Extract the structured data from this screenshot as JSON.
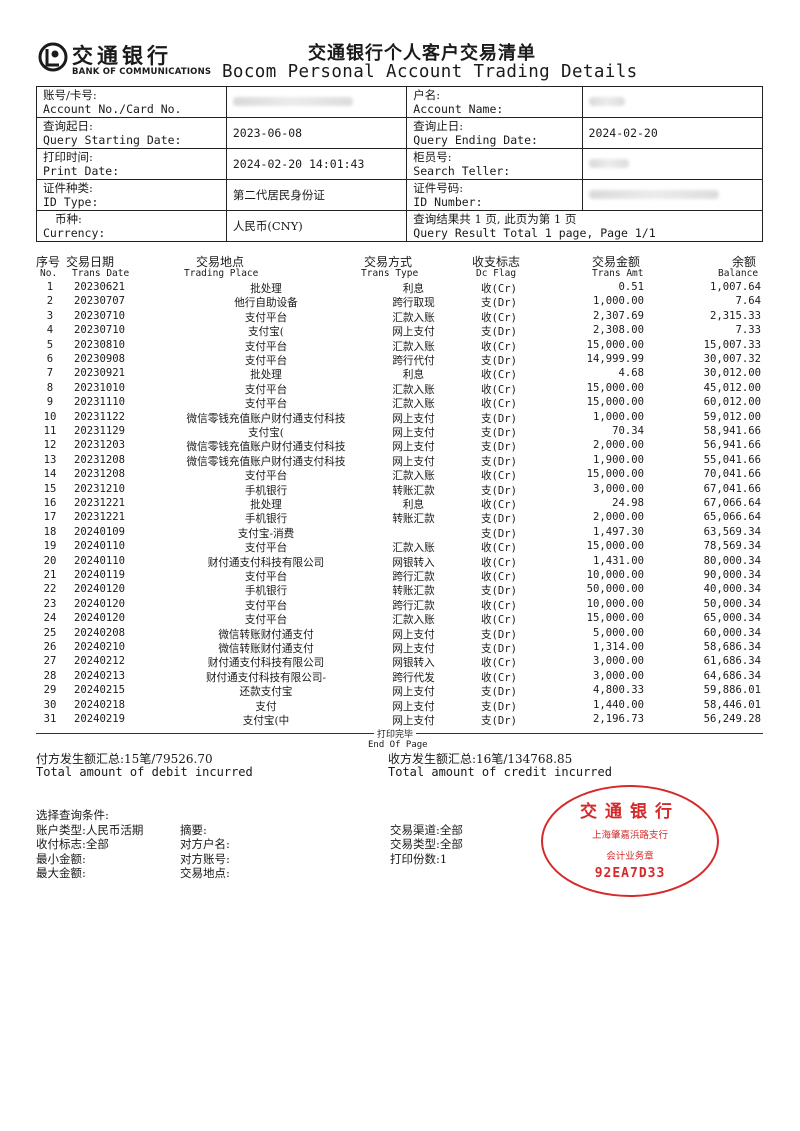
{
  "header": {
    "bank_name_cn": "交通银行",
    "bank_name_en": "BANK OF COMMUNICATIONS",
    "title_cn": "交通银行个人客户交易清单",
    "title_en": "Bocom Personal Account Trading Details",
    "brand_color": "#1a1a1a"
  },
  "info": {
    "account_label_cn": "账号/卡号:",
    "account_label_en": "Account No./Card No.",
    "name_label_cn": "户名:",
    "name_label_en": "Account Name:",
    "start_label_cn": "查询起日:",
    "start_label_en": "Query Starting Date:",
    "start_value": "2023-06-08",
    "end_label_cn": "查询止日:",
    "end_label_en": "Query Ending Date:",
    "end_value": "2024-02-20",
    "print_label_cn": "打印时间:",
    "print_label_en": "Print Date:",
    "print_value": "2024-02-20 14:01:43",
    "teller_label_cn": "柜员号:",
    "teller_label_en": "Search Teller:",
    "idtype_label_cn": "证件种类:",
    "idtype_label_en": "ID Type:",
    "idtype_value": "第二代居民身份证",
    "idnum_label_cn": "证件号码:",
    "idnum_label_en": "ID Number:",
    "currency_label_cn": "币种:",
    "currency_label_en": "Currency:",
    "currency_value": "人民币(CNY)",
    "result_cn": "查询结果共 1 页, 此页为第 1 页",
    "result_en": "Query Result Total 1 page, Page 1/1"
  },
  "columns": {
    "no_cn": "序号",
    "no_en": "No.",
    "date_cn": "交易日期",
    "date_en": "Trans Date",
    "place_cn": "交易地点",
    "place_en": "Trading Place",
    "type_cn": "交易方式",
    "type_en": "Trans Type",
    "flag_cn": "收支标志",
    "flag_en": "Dc Flag",
    "amt_cn": "交易金额",
    "amt_en": "Trans Amt",
    "bal_cn": "余额",
    "bal_en": "Balance"
  },
  "transactions": [
    {
      "no": "1",
      "date": "20230621",
      "place": "批处理",
      "type": "利息",
      "flag": "收(Cr)",
      "amt": "0.51",
      "bal": "1,007.64"
    },
    {
      "no": "2",
      "date": "20230707",
      "place": "他行自助设备",
      "type": "跨行取现",
      "flag": "支(Dr)",
      "amt": "1,000.00",
      "bal": "7.64"
    },
    {
      "no": "3",
      "date": "20230710",
      "place": "支付平台",
      "type": "汇款入账",
      "flag": "收(Cr)",
      "amt": "2,307.69",
      "bal": "2,315.33"
    },
    {
      "no": "4",
      "date": "20230710",
      "place": "支付宝(",
      "type": "网上支付",
      "flag": "支(Dr)",
      "amt": "2,308.00",
      "bal": "7.33"
    },
    {
      "no": "5",
      "date": "20230810",
      "place": "支付平台",
      "type": "汇款入账",
      "flag": "收(Cr)",
      "amt": "15,000.00",
      "bal": "15,007.33"
    },
    {
      "no": "6",
      "date": "20230908",
      "place": "支付平台",
      "type": "跨行代付",
      "flag": "支(Dr)",
      "amt": "14,999.99",
      "bal": "30,007.32"
    },
    {
      "no": "7",
      "date": "20230921",
      "place": "批处理",
      "type": "利息",
      "flag": "收(Cr)",
      "amt": "4.68",
      "bal": "30,012.00"
    },
    {
      "no": "8",
      "date": "20231010",
      "place": "支付平台",
      "type": "汇款入账",
      "flag": "收(Cr)",
      "amt": "15,000.00",
      "bal": "45,012.00"
    },
    {
      "no": "9",
      "date": "20231110",
      "place": "支付平台",
      "type": "汇款入账",
      "flag": "收(Cr)",
      "amt": "15,000.00",
      "bal": "60,012.00"
    },
    {
      "no": "10",
      "date": "20231122",
      "place": "微信零钱充值账户财付通支付科技",
      "type": "网上支付",
      "flag": "支(Dr)",
      "amt": "1,000.00",
      "bal": "59,012.00"
    },
    {
      "no": "11",
      "date": "20231129",
      "place": "支付宝(",
      "type": "网上支付",
      "flag": "支(Dr)",
      "amt": "70.34",
      "bal": "58,941.66"
    },
    {
      "no": "12",
      "date": "20231203",
      "place": "微信零钱充值账户财付通支付科技",
      "type": "网上支付",
      "flag": "支(Dr)",
      "amt": "2,000.00",
      "bal": "56,941.66"
    },
    {
      "no": "13",
      "date": "20231208",
      "place": "微信零钱充值账户财付通支付科技",
      "type": "网上支付",
      "flag": "支(Dr)",
      "amt": "1,900.00",
      "bal": "55,041.66"
    },
    {
      "no": "14",
      "date": "20231208",
      "place": "支付平台",
      "type": "汇款入账",
      "flag": "收(Cr)",
      "amt": "15,000.00",
      "bal": "70,041.66"
    },
    {
      "no": "15",
      "date": "20231210",
      "place": "手机银行",
      "type": "转账汇款",
      "flag": "支(Dr)",
      "amt": "3,000.00",
      "bal": "67,041.66"
    },
    {
      "no": "16",
      "date": "20231221",
      "place": "批处理",
      "type": "利息",
      "flag": "收(Cr)",
      "amt": "24.98",
      "bal": "67,066.64"
    },
    {
      "no": "17",
      "date": "20231221",
      "place": "手机银行",
      "type": "转账汇款",
      "flag": "支(Dr)",
      "amt": "2,000.00",
      "bal": "65,066.64"
    },
    {
      "no": "18",
      "date": "20240109",
      "place": "支付宝-消费",
      "type": "",
      "flag": "支(Dr)",
      "amt": "1,497.30",
      "bal": "63,569.34"
    },
    {
      "no": "19",
      "date": "20240110",
      "place": "支付平台",
      "type": "汇款入账",
      "flag": "收(Cr)",
      "amt": "15,000.00",
      "bal": "78,569.34"
    },
    {
      "no": "20",
      "date": "20240110",
      "place": "财付通支付科技有限公司",
      "type": "网银转入",
      "flag": "收(Cr)",
      "amt": "1,431.00",
      "bal": "80,000.34"
    },
    {
      "no": "21",
      "date": "20240119",
      "place": "支付平台",
      "type": "跨行汇款",
      "flag": "收(Cr)",
      "amt": "10,000.00",
      "bal": "90,000.34"
    },
    {
      "no": "22",
      "date": "20240120",
      "place": "手机银行",
      "type": "转账汇款",
      "flag": "支(Dr)",
      "amt": "50,000.00",
      "bal": "40,000.34"
    },
    {
      "no": "23",
      "date": "20240120",
      "place": "支付平台",
      "type": "跨行汇款",
      "flag": "收(Cr)",
      "amt": "10,000.00",
      "bal": "50,000.34"
    },
    {
      "no": "24",
      "date": "20240120",
      "place": "支付平台",
      "type": "汇款入账",
      "flag": "收(Cr)",
      "amt": "15,000.00",
      "bal": "65,000.34"
    },
    {
      "no": "25",
      "date": "20240208",
      "place": "微信转账财付通支付",
      "type": "网上支付",
      "flag": "支(Dr)",
      "amt": "5,000.00",
      "bal": "60,000.34"
    },
    {
      "no": "26",
      "date": "20240210",
      "place": "微信转账财付通支付",
      "type": "网上支付",
      "flag": "支(Dr)",
      "amt": "1,314.00",
      "bal": "58,686.34"
    },
    {
      "no": "27",
      "date": "20240212",
      "place": "财付通支付科技有限公司",
      "type": "网银转入",
      "flag": "收(Cr)",
      "amt": "3,000.00",
      "bal": "61,686.34"
    },
    {
      "no": "28",
      "date": "20240213",
      "place": "财付通支付科技有限公司-",
      "type": "跨行代发",
      "flag": "收(Cr)",
      "amt": "3,000.00",
      "bal": "64,686.34"
    },
    {
      "no": "29",
      "date": "20240215",
      "place": "还款支付宝",
      "type": "网上支付",
      "flag": "支(Dr)",
      "amt": "4,800.33",
      "bal": "59,886.01"
    },
    {
      "no": "30",
      "date": "20240218",
      "place": "支付",
      "type": "网上支付",
      "flag": "支(Dr)",
      "amt": "1,440.00",
      "bal": "58,446.01"
    },
    {
      "no": "31",
      "date": "20240219",
      "place": "支付宝(中",
      "type": "网上支付",
      "flag": "支(Dr)",
      "amt": "2,196.73",
      "bal": "56,249.28"
    }
  ],
  "end_cn": "打印完毕",
  "end_en": "End Of Page",
  "summary": {
    "debit_cn": "付方发生额汇总:15笔/79526.70",
    "debit_en": "Total amount of debit incurred",
    "credit_cn": "收方发生额汇总:16笔/134768.85",
    "credit_en": "Total amount of credit incurred"
  },
  "conditions": {
    "title": "选择查询条件:",
    "account_type": "账户类型:人民币活期",
    "summary": "摘要:",
    "channel": "交易渠道:全部",
    "flag": "收付标志:全部",
    "counterparty_name": "对方户名:",
    "trans_type": "交易类型:全部",
    "min_amount": "最小金额:",
    "counterparty_account": "对方账号:",
    "copies": "打印份数:1",
    "max_amount": "最大金额:",
    "place": "交易地点:"
  },
  "stamp": {
    "bank": "交通银行",
    "branch": "上海肇嘉浜路支行",
    "dept": "会计业务章",
    "code": "92EA7D33",
    "color": "#d62a2a"
  }
}
